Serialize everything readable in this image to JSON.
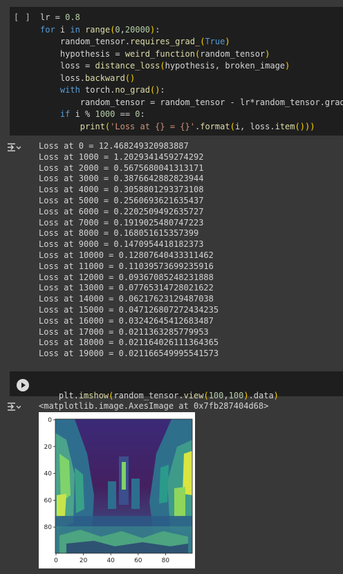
{
  "cell1": {
    "bracket": "[ ]",
    "lines": [
      [
        "lr = 0.8"
      ],
      [
        "for i in range(0,20000):"
      ],
      [
        "    random_tensor.requires_grad_(True)"
      ],
      [
        "    hypothesis = weird_function(random_tensor)"
      ],
      [
        "    loss = distance_loss(hypothesis, broken_image)"
      ],
      [
        "    loss.backward()"
      ],
      [
        "    with torch.no_grad():"
      ],
      [
        "        random_tensor = random_tensor - lr*random_tensor.grad"
      ],
      [
        "    if i % 1000 == 0:"
      ],
      [
        "        print('Loss at {} = {}'.format(i, loss.item()))"
      ]
    ]
  },
  "output1": {
    "lines": [
      "Loss at 0 = 12.468249320983887",
      "Loss at 1000 = 1.2029341459274292",
      "Loss at 2000 = 0.5675680041313171",
      "Loss at 3000 = 0.3876642882823944",
      "Loss at 4000 = 0.3058801293373108",
      "Loss at 5000 = 0.2560693621635437",
      "Loss at 6000 = 0.2202509492635727",
      "Loss at 7000 = 0.1919025480747223",
      "Loss at 8000 = 0.168051615357399",
      "Loss at 9000 = 0.1470954418182373",
      "Loss at 10000 = 0.12807640433311462",
      "Loss at 11000 = 0.11039573699235916",
      "Loss at 12000 = 0.09367085248231888",
      "Loss at 13000 = 0.07765314728021622",
      "Loss at 14000 = 0.06217623129487038",
      "Loss at 15000 = 0.047126807272434235",
      "Loss at 16000 = 0.03242645412683487",
      "Loss at 17000 = 0.0211363285779953",
      "Loss at 18000 = 0.021164026111364365",
      "Loss at 19000 = 0.021166549995541573"
    ]
  },
  "cell2": {
    "code": "plt.imshow(random_tensor.view(100,100).data)"
  },
  "output2": {
    "text": "<matplotlib.image.AxesImage at 0x7fb287404d68>",
    "ticks_y": [
      "0",
      "20",
      "40",
      "60",
      "80"
    ],
    "ticks_x": [
      "0",
      "20",
      "40",
      "60",
      "80"
    ]
  },
  "icons": {
    "run": "play-icon",
    "output": "output-toggle-icon"
  }
}
